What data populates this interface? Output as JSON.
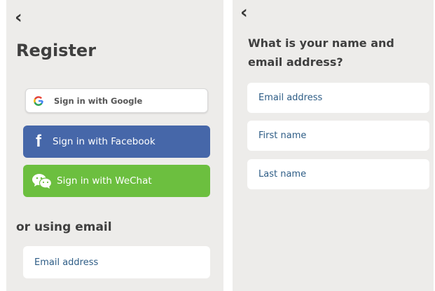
{
  "left_screen": {
    "title": "Register",
    "google_button": "Sign in with Google",
    "facebook_button": "Sign in with Facebook",
    "wechat_button": "Sign in with WeChat",
    "email_section_title": "or using email",
    "email_field": "Email address",
    "colors": {
      "facebook": "#4667a9",
      "wechat": "#6cbf3f",
      "google_label": "#555555"
    }
  },
  "right_screen": {
    "heading": "What is your name and email address?",
    "fields": [
      {
        "label": "Email address"
      },
      {
        "label": "First name"
      },
      {
        "label": "Last name"
      }
    ]
  },
  "icons": [
    "back-chevron-icon",
    "google-g-icon",
    "facebook-f-icon",
    "wechat-icon"
  ]
}
